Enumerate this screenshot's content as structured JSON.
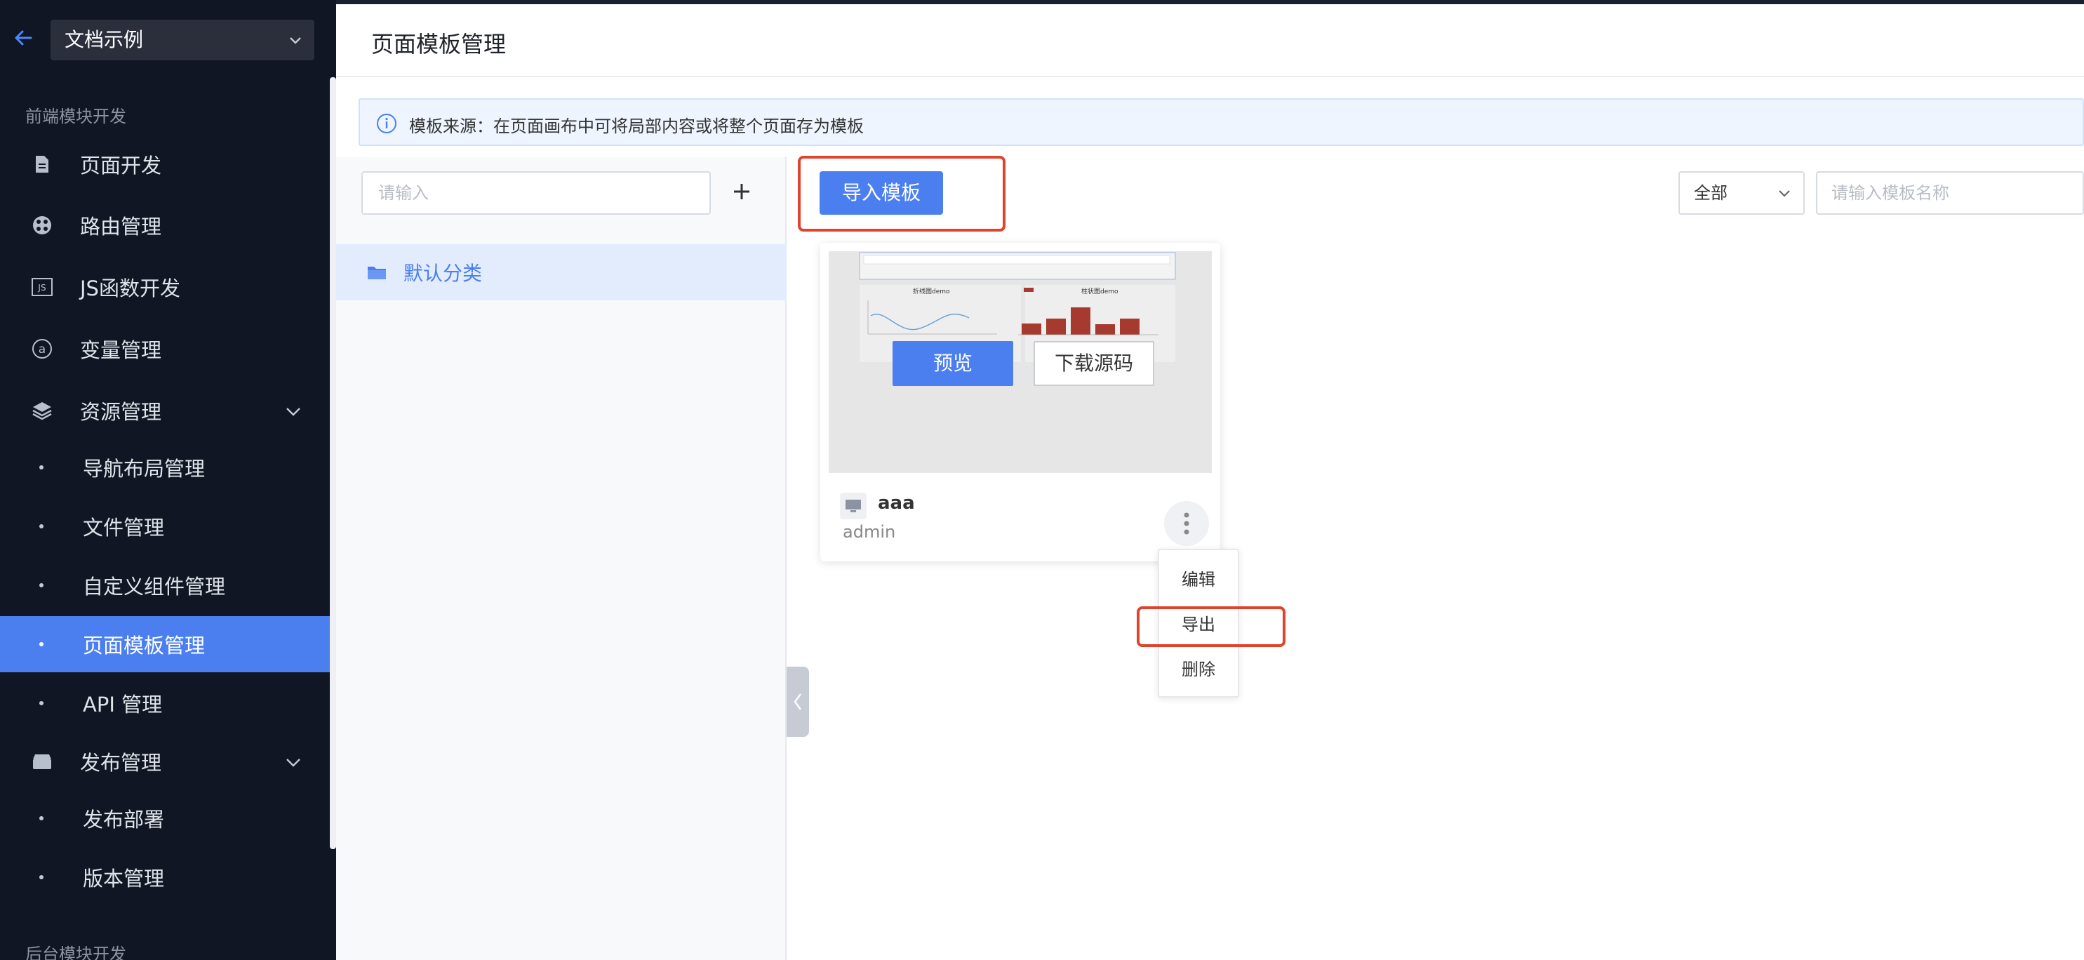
{
  "project": {
    "name": "文档示例"
  },
  "sidebar": {
    "section_frontend": "前端模块开发",
    "section_backend": "后台模块开发",
    "items": [
      {
        "label": "页面开发",
        "icon": "document-icon"
      },
      {
        "label": "路由管理",
        "icon": "route-icon"
      },
      {
        "label": "JS函数开发",
        "icon": "js-icon"
      },
      {
        "label": "变量管理",
        "icon": "at-icon"
      },
      {
        "label": "资源管理",
        "icon": "layers-icon",
        "expanded": true
      },
      {
        "label": "发布管理",
        "icon": "archive-icon",
        "expanded": true
      }
    ],
    "resource_children": [
      "导航布局管理",
      "文件管理",
      "自定义组件管理",
      "页面模板管理",
      "API 管理"
    ],
    "publish_children": [
      "发布部署",
      "版本管理"
    ],
    "active_item": "页面模板管理"
  },
  "page": {
    "title": "页面模板管理",
    "info": "模板来源：在页面画布中可将局部内容或将整个页面存为模板"
  },
  "category_panel": {
    "search_placeholder": "请输入",
    "categories": [
      {
        "label": "默认分类",
        "selected": true
      }
    ]
  },
  "toolbar": {
    "import_label": "导入模板",
    "filter_value": "全部",
    "name_placeholder": "请输入模板名称"
  },
  "templates": [
    {
      "name": "aaa",
      "owner": "admin",
      "preview_label": "预览",
      "download_label": "下载源码",
      "thumb_line_title": "折线图demo",
      "thumb_bar_title": "柱状图demo"
    }
  ],
  "card_menu": {
    "items": [
      "编辑",
      "导出",
      "删除"
    ],
    "highlighted": "导出"
  },
  "colors": {
    "accent": "#4b7ff0",
    "sidebar_bg": "#101623",
    "highlight_box": "#e0432c"
  }
}
